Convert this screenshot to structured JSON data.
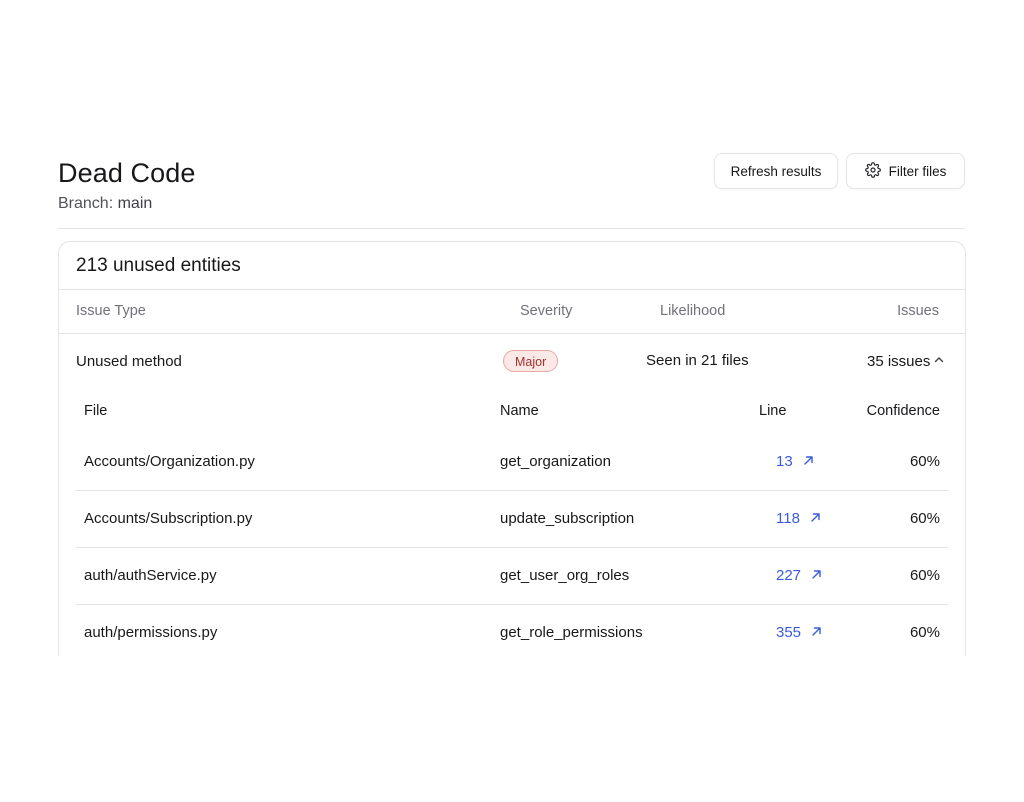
{
  "header": {
    "title": "Dead Code",
    "branch_label": "Branch:",
    "branch_value": "main",
    "refresh_button": "Refresh results",
    "filter_button": "Filter files"
  },
  "summary": {
    "title": "213 unused entities",
    "columns": {
      "issue_type": "Issue Type",
      "severity": "Severity",
      "likelihood": "Likelihood",
      "issues": "Issues"
    }
  },
  "group": {
    "issue_type": "Unused method",
    "severity": "Major",
    "likelihood": "Seen in 21 files",
    "issues": "35 issues",
    "expanded": true,
    "columns": {
      "file": "File",
      "name": "Name",
      "line": "Line",
      "confidence": "Confidence"
    },
    "rows": [
      {
        "file": "Accounts/Organization.py",
        "name": "get_organization",
        "line": "13",
        "confidence": "60%"
      },
      {
        "file": "Accounts/Subscription.py",
        "name": "update_subscription",
        "line": "118",
        "confidence": "60%"
      },
      {
        "file": "auth/authService.py",
        "name": "get_user_org_roles",
        "line": "227",
        "confidence": "60%"
      },
      {
        "file": "auth/permissions.py",
        "name": "get_role_permissions",
        "line": "355",
        "confidence": "60%"
      }
    ]
  },
  "colors": {
    "link": "#3b5bdb",
    "badge_bg": "#fbe9e7",
    "badge_border": "#e8a8a4",
    "badge_text": "#a1312a",
    "border": "#e4e4e7"
  },
  "icons": {
    "filter": "gear-icon",
    "collapse": "chevron-up-icon",
    "open_line": "arrow-up-right-icon"
  }
}
